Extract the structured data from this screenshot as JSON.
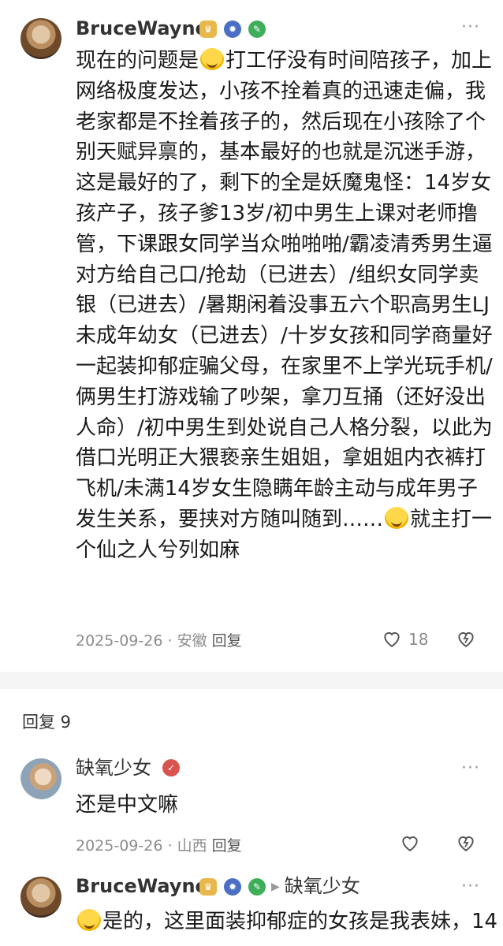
{
  "post": {
    "username": "BruceWayne",
    "lines": [
      [
        "现在的问题是",
        "emoji",
        "打工仔没有时间陪孩子，加上"
      ],
      [
        "网络极度发达，小孩不拴着真的迅速走偏，我"
      ],
      [
        "老家都是不拴着孩子的，然后现在小孩除了个"
      ],
      [
        "别天赋异禀的，基本最好的也就是沉迷手游，"
      ],
      [
        "这是最好的了，剩下的全是妖魔鬼怪：14岁女"
      ],
      [
        "孩产子，孩子爹13岁/初中男生上课对老师撸"
      ],
      [
        "管，下课跟女同学当众啪啪啪/霸凌清秀男生逼"
      ],
      [
        "对方给自己口/抢劫（已进去）/组织女同学卖"
      ],
      [
        "银（已进去）/暑期闲着没事五六个职高男生LJ"
      ],
      [
        "未成年幼女（已进去）/十岁女孩和同学商量好"
      ],
      [
        "一起装抑郁症骗父母，在家里不上学光玩手机/"
      ],
      [
        "俩男生打游戏输了吵架，拿刀互捅（还好没出"
      ],
      [
        "人命）/初中男生到处说自己人格分裂，以此为"
      ],
      [
        "借口光明正大猥亵亲生姐姐，拿姐姐内衣裤打"
      ],
      [
        "飞机/未满14岁女生隐瞒年龄主动与成年男子"
      ],
      [
        "发生关系，要挟对方随叫随到……",
        "emoji",
        "就主打一"
      ],
      [
        "个仙之人兮列如麻"
      ]
    ],
    "date": "2025-09-26",
    "location": "安徽",
    "reply_label": "回复",
    "like_count": "18"
  },
  "replies_header": "回复 9",
  "reply1": {
    "username": "缺氧少女",
    "text": "还是中文嘛",
    "date": "2025-09-26",
    "location": "山西",
    "reply_label": "回复"
  },
  "reply2": {
    "username": "BruceWayne",
    "reply_to": "缺氧少女",
    "text_start": "是的，这里面装抑郁症的女孩是我表妹，14"
  },
  "icons": {
    "more": "more-dots-icon",
    "like": "heart-icon",
    "share": "share-icon",
    "crown": "crown-badge-icon",
    "gear": "gear-badge-icon",
    "leaf": "leaf-badge-icon",
    "check": "verified-badge-icon",
    "emoji": "laughing-crying-emoji"
  }
}
